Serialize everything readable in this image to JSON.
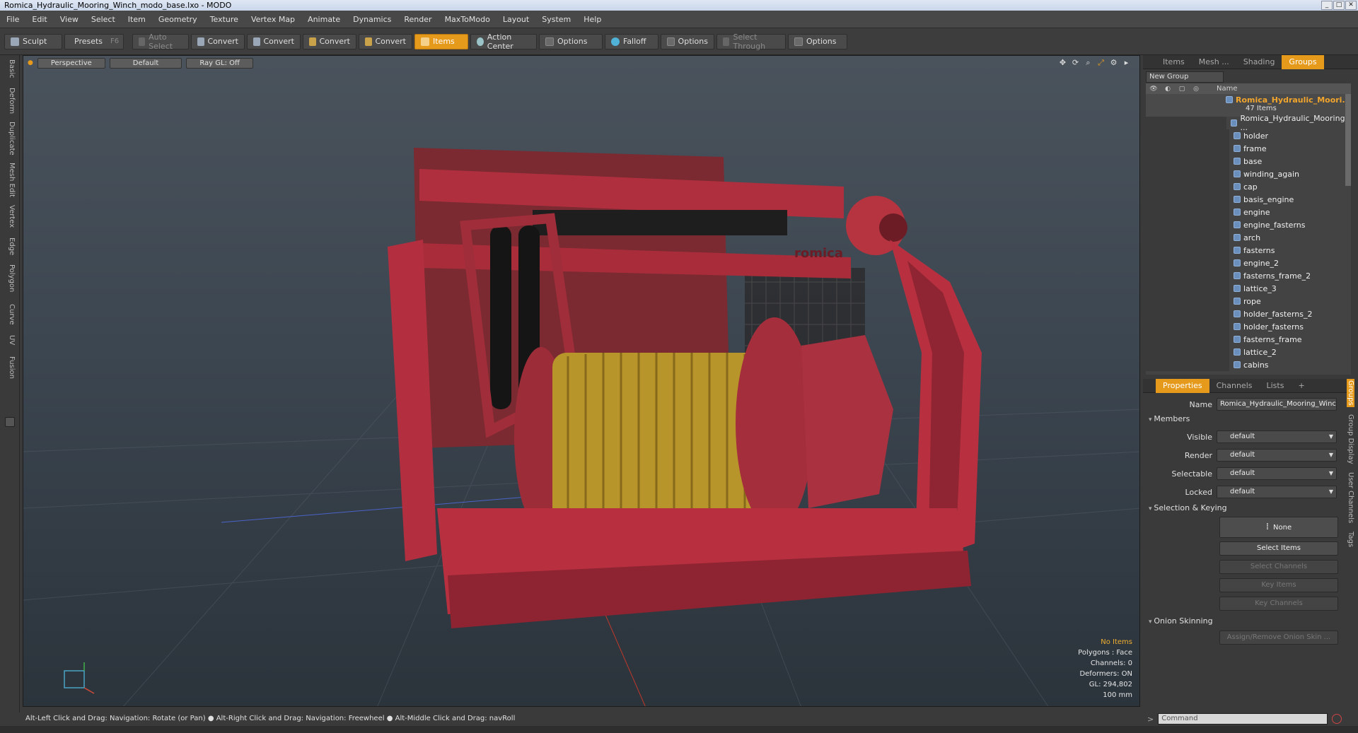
{
  "window": {
    "title": "Romica_Hydraulic_Mooring_Winch_modo_base.lxo - MODO"
  },
  "menu": [
    "File",
    "Edit",
    "View",
    "Select",
    "Item",
    "Geometry",
    "Texture",
    "Vertex Map",
    "Animate",
    "Dynamics",
    "Render",
    "MaxToModo",
    "Layout",
    "System",
    "Help"
  ],
  "toolbar": {
    "sculpt": "Sculpt",
    "presets": "Presets",
    "presets_key": "F6",
    "auto_select": "Auto Select",
    "convert1": "Convert",
    "convert2": "Convert",
    "convert3": "Convert",
    "convert4": "Convert",
    "items": "Items",
    "action_center": "Action Center",
    "options1": "Options",
    "falloff": "Falloff",
    "options2": "Options",
    "select_through": "Select Through",
    "options3": "Options"
  },
  "left_tabs": [
    "Basic",
    "Deform",
    "Duplicate",
    "Mesh Edit",
    "Vertex",
    "Edge",
    "Polygon",
    "Curve",
    "UV",
    "Fusion"
  ],
  "viewport": {
    "perspective": "Perspective",
    "default": "Default",
    "raygl": "Ray GL: Off",
    "stats": {
      "no_items": "No Items",
      "polygons": "Polygons : Face",
      "channels": "Channels: 0",
      "deformers": "Deformers: ON",
      "gl": "GL: 294,802",
      "size": "100 mm"
    },
    "logo_text": "romica"
  },
  "status": "Alt-Left Click and Drag: Navigation: Rotate (or Pan) ● Alt-Right Click and Drag: Navigation: Freewheel ● Alt-Middle Click and Drag: navRoll",
  "right_panel": {
    "tabs": [
      "Items",
      "Mesh ...",
      "Shading",
      "Groups"
    ],
    "new_group": "New Group",
    "name_header": "Name",
    "group": {
      "name": "Romica_Hydraulic_Moori...",
      "count": "47 Items"
    },
    "items": [
      "Romica_Hydraulic_Mooring ...",
      "holder",
      "frame",
      "base",
      "winding_again",
      "cap",
      "basis_engine",
      "engine",
      "engine_fasterns",
      "arch",
      "fasterns",
      "engine_2",
      "fasterns_frame_2",
      "lattice_3",
      "rope",
      "holder_fasterns_2",
      "holder_fasterns",
      "fasterns_frame",
      "lattice_2",
      "cabins"
    ],
    "prop_tabs": [
      "Properties",
      "Channels",
      "Lists",
      "+"
    ],
    "props": {
      "name_label": "Name",
      "name_value": "Romica_Hydraulic_Mooring_Winc",
      "members": "Members",
      "visible_label": "Visible",
      "visible_value": "default",
      "render_label": "Render",
      "render_value": "default",
      "selectable_label": "Selectable",
      "selectable_value": "default",
      "locked_label": "Locked",
      "locked_value": "default",
      "selection_keying": "Selection & Keying",
      "none": "None",
      "select_items": "Select Items",
      "select_channels": "Select Channels",
      "key_items": "Key Items",
      "key_channels": "Key Channels",
      "onion": "Onion Skinning",
      "onion_btn": "Assign/Remove Onion Skin ..."
    },
    "side_tabs": [
      "Groups",
      "Group Display",
      "User Channels",
      "Tags"
    ]
  },
  "command": {
    "placeholder": "Command"
  },
  "colors": {
    "accent": "#e69a1c",
    "model_red": "#b8303f",
    "rope": "#b8952a"
  }
}
